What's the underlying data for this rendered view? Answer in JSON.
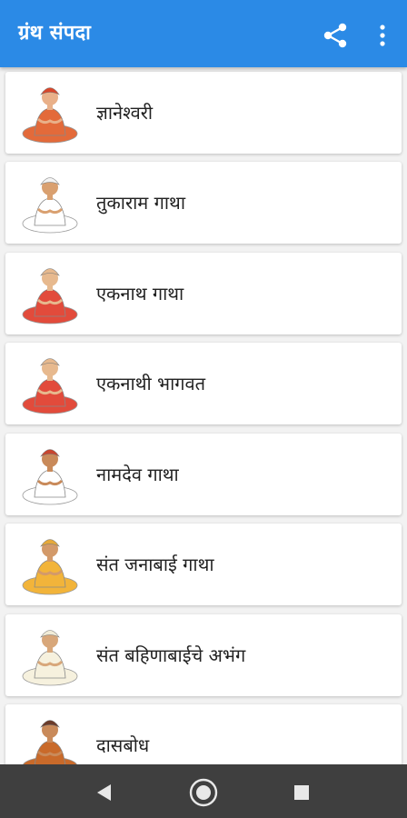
{
  "app_bar": {
    "title": "ग्रंथ संपदा",
    "share_icon": "share-icon",
    "menu_icon": "more-vert-icon"
  },
  "items": [
    {
      "label": "ज्ञानेश्वरी",
      "icon": "saint-portrait",
      "colors": {
        "turban": "#d9472b",
        "robe": "#e36a3a",
        "skin": "#e9b089"
      }
    },
    {
      "label": "तुकाराम गाथा",
      "icon": "saint-portrait",
      "colors": {
        "turban": "#f3f3f3",
        "robe": "#ffffff",
        "skin": "#d9a070"
      }
    },
    {
      "label": "एकनाथ गाथा",
      "icon": "saint-portrait",
      "colors": {
        "turban": "#e7b98e",
        "robe": "#e24b3b",
        "skin": "#e7b98e"
      }
    },
    {
      "label": "एकनाथी भागवत",
      "icon": "saint-portrait",
      "colors": {
        "turban": "#e7b98e",
        "robe": "#e24b3b",
        "skin": "#e7b98e"
      }
    },
    {
      "label": "नामदेव गाथा",
      "icon": "saint-portrait",
      "colors": {
        "turban": "#c8462f",
        "robe": "#ffffff",
        "skin": "#c98a5a"
      }
    },
    {
      "label": "संत जनाबाई गाथा",
      "icon": "saint-portrait",
      "colors": {
        "turban": "#e6a93a",
        "robe": "#f2b43a",
        "skin": "#d39a6a"
      }
    },
    {
      "label": "संत बहिणाबाईचे अभंग",
      "icon": "saint-portrait",
      "colors": {
        "turban": "#f1ecd8",
        "robe": "#f6f1de",
        "skin": "#d8a77a"
      }
    },
    {
      "label": "दासबोध",
      "icon": "saint-portrait",
      "colors": {
        "turban": "#6b3b2a",
        "robe": "#c96a2a",
        "skin": "#c98a5a"
      }
    }
  ],
  "nav_bar": {
    "back_icon": "back-triangle-icon",
    "home_icon": "home-circle-icon",
    "recents_icon": "recents-square-icon"
  },
  "theme": {
    "app_bar_color": "#2b8ae6",
    "nav_bar_color": "#3f3f3f",
    "background": "#f2f2f2"
  }
}
